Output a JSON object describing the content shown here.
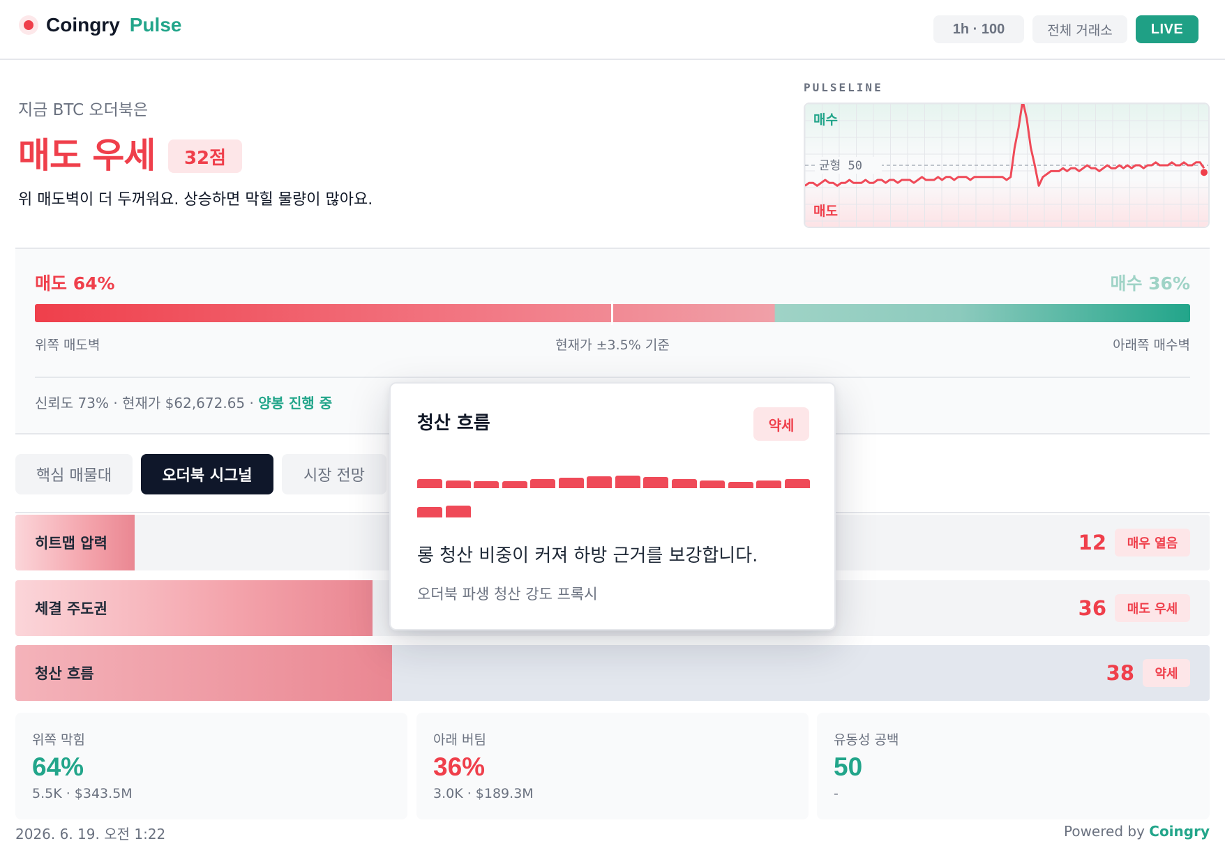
{
  "header": {
    "brand": "Coingry",
    "brand_sub": "Pulse",
    "timeframe": "1h · 100",
    "exchange": "전체 거래소",
    "live": "LIVE"
  },
  "hero": {
    "label": "지금 BTC 오더북은",
    "title": "매도 우세",
    "score": "32점",
    "description": "위 매도벽이 더 두꺼워요. 상승하면 막힐 물량이 많아요."
  },
  "pulseline": {
    "label": "PULSELINE",
    "buy_label": "매수",
    "sell_label": "매도",
    "balance_label": "균형 50",
    "values": [
      43,
      44,
      44,
      43,
      44,
      45,
      44,
      44,
      43,
      44,
      44,
      45,
      44,
      44,
      44,
      45,
      44,
      44,
      45,
      45,
      44,
      45,
      45,
      44,
      45,
      45,
      45,
      44,
      45,
      46,
      45,
      45,
      45,
      46,
      45,
      46,
      46,
      45,
      46,
      46,
      46,
      45,
      46,
      46,
      46,
      46,
      46,
      46,
      46,
      46,
      45,
      46,
      56,
      63,
      72,
      66,
      56,
      50,
      43,
      46,
      47,
      48,
      48,
      48,
      49,
      48,
      49,
      49,
      48,
      49,
      50,
      49,
      49,
      48,
      49,
      50,
      49,
      49,
      50,
      49,
      50,
      49,
      50,
      50,
      49,
      50,
      50,
      51,
      50,
      50,
      50,
      51,
      50,
      50,
      51,
      50,
      50,
      51,
      51,
      49
    ]
  },
  "balance": {
    "sell_label": "매도 64%",
    "buy_label": "매수 36%",
    "sell_pct": 64,
    "buy_pct": 36,
    "left_caption": "위쪽 매도벽",
    "center_caption": "현재가 ±3.5% 기준",
    "right_caption": "아래쪽 매수벽",
    "footer_meta": "신뢰도 73% · 현재가 $62,672.65 · ",
    "footer_status": "양봉 진행 중"
  },
  "tabs": [
    {
      "label": "핵심 매물대",
      "active": false
    },
    {
      "label": "오더북 시그널",
      "active": true
    },
    {
      "label": "시장 전망",
      "active": false
    }
  ],
  "signals": [
    {
      "label": "히트맵 압력",
      "value": "12",
      "badge": "매우 열음",
      "score": 12
    },
    {
      "label": "체결 주도권",
      "value": "36",
      "badge": "매도 우세",
      "score": 36
    },
    {
      "label": "청산 흐름",
      "value": "38",
      "badge": "약세",
      "score": 38
    }
  ],
  "cards": [
    {
      "label": "위쪽 막힘",
      "value": "64%",
      "sub": "5.5K · $343.5M",
      "color": "#22a58a"
    },
    {
      "label": "아래 버팀",
      "value": "36%",
      "sub": "3.0K · $189.3M",
      "color": "#ef3f4b"
    },
    {
      "label": "유동성 공백",
      "value": "50",
      "sub": "-",
      "color": "#22a58a"
    }
  ],
  "footer": {
    "date": "2026. 6. 19. 오전 1:22",
    "powered": "Powered by",
    "brand": "Coingry"
  },
  "popover": {
    "title": "청산 흐름",
    "badge": "약세",
    "description": "롱 청산 비중이 커져 하방 근거를 보강합니다.",
    "note": "오더북 파생 청산 강도 프록시",
    "bars": [
      0.45,
      0.38,
      0.35,
      0.36,
      0.45,
      0.55,
      0.62,
      0.65,
      0.57,
      0.48,
      0.38,
      0.33,
      0.38,
      0.48,
      0.55,
      0.62
    ],
    "bar_color": "#ef4a58"
  },
  "colors": {
    "sell": "#ef3f4b",
    "buy": "#22a58a",
    "dark": "#0f172a"
  }
}
